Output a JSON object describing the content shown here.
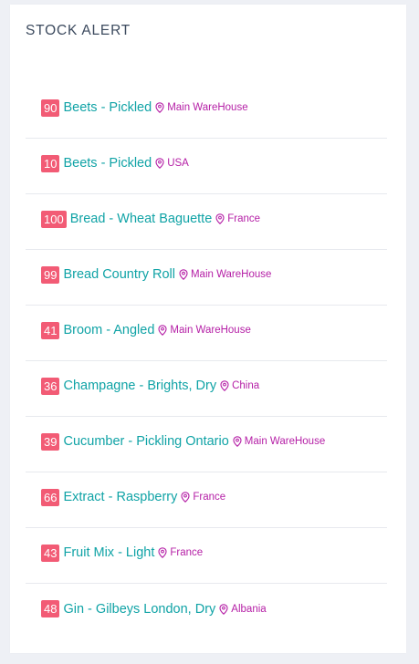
{
  "card": {
    "title": "STOCK ALERT"
  },
  "colors": {
    "badge": "#f25b75",
    "product": "#10a3a6",
    "location": "#b51fa6",
    "title": "#3c4a5e"
  },
  "alerts": [
    {
      "qty": "90",
      "product": "Beets - Pickled",
      "location": "Main WareHouse",
      "location_icon": "map-pin-icon"
    },
    {
      "qty": "10",
      "product": "Beets - Pickled",
      "location": "USA",
      "location_icon": "map-pin-icon"
    },
    {
      "qty": "100",
      "product": "Bread - Wheat Baguette",
      "location": "France",
      "location_icon": "map-pin-icon"
    },
    {
      "qty": "99",
      "product": "Bread Country Roll",
      "location": "Main WareHouse",
      "location_icon": "map-pin-icon"
    },
    {
      "qty": "41",
      "product": "Broom - Angled",
      "location": "Main WareHouse",
      "location_icon": "map-pin-icon"
    },
    {
      "qty": "36",
      "product": "Champagne - Brights, Dry",
      "location": "China",
      "location_icon": "map-pin-icon"
    },
    {
      "qty": "39",
      "product": "Cucumber - Pickling Ontario",
      "location": "Main WareHouse",
      "location_icon": "map-pin-icon"
    },
    {
      "qty": "66",
      "product": "Extract - Raspberry",
      "location": "France",
      "location_icon": "map-pin-icon"
    },
    {
      "qty": "43",
      "product": "Fruit Mix - Light",
      "location": "France",
      "location_icon": "map-pin-icon"
    },
    {
      "qty": "48",
      "product": "Gin - Gilbeys London, Dry",
      "location": "Albania",
      "location_icon": "map-pin-icon"
    }
  ]
}
